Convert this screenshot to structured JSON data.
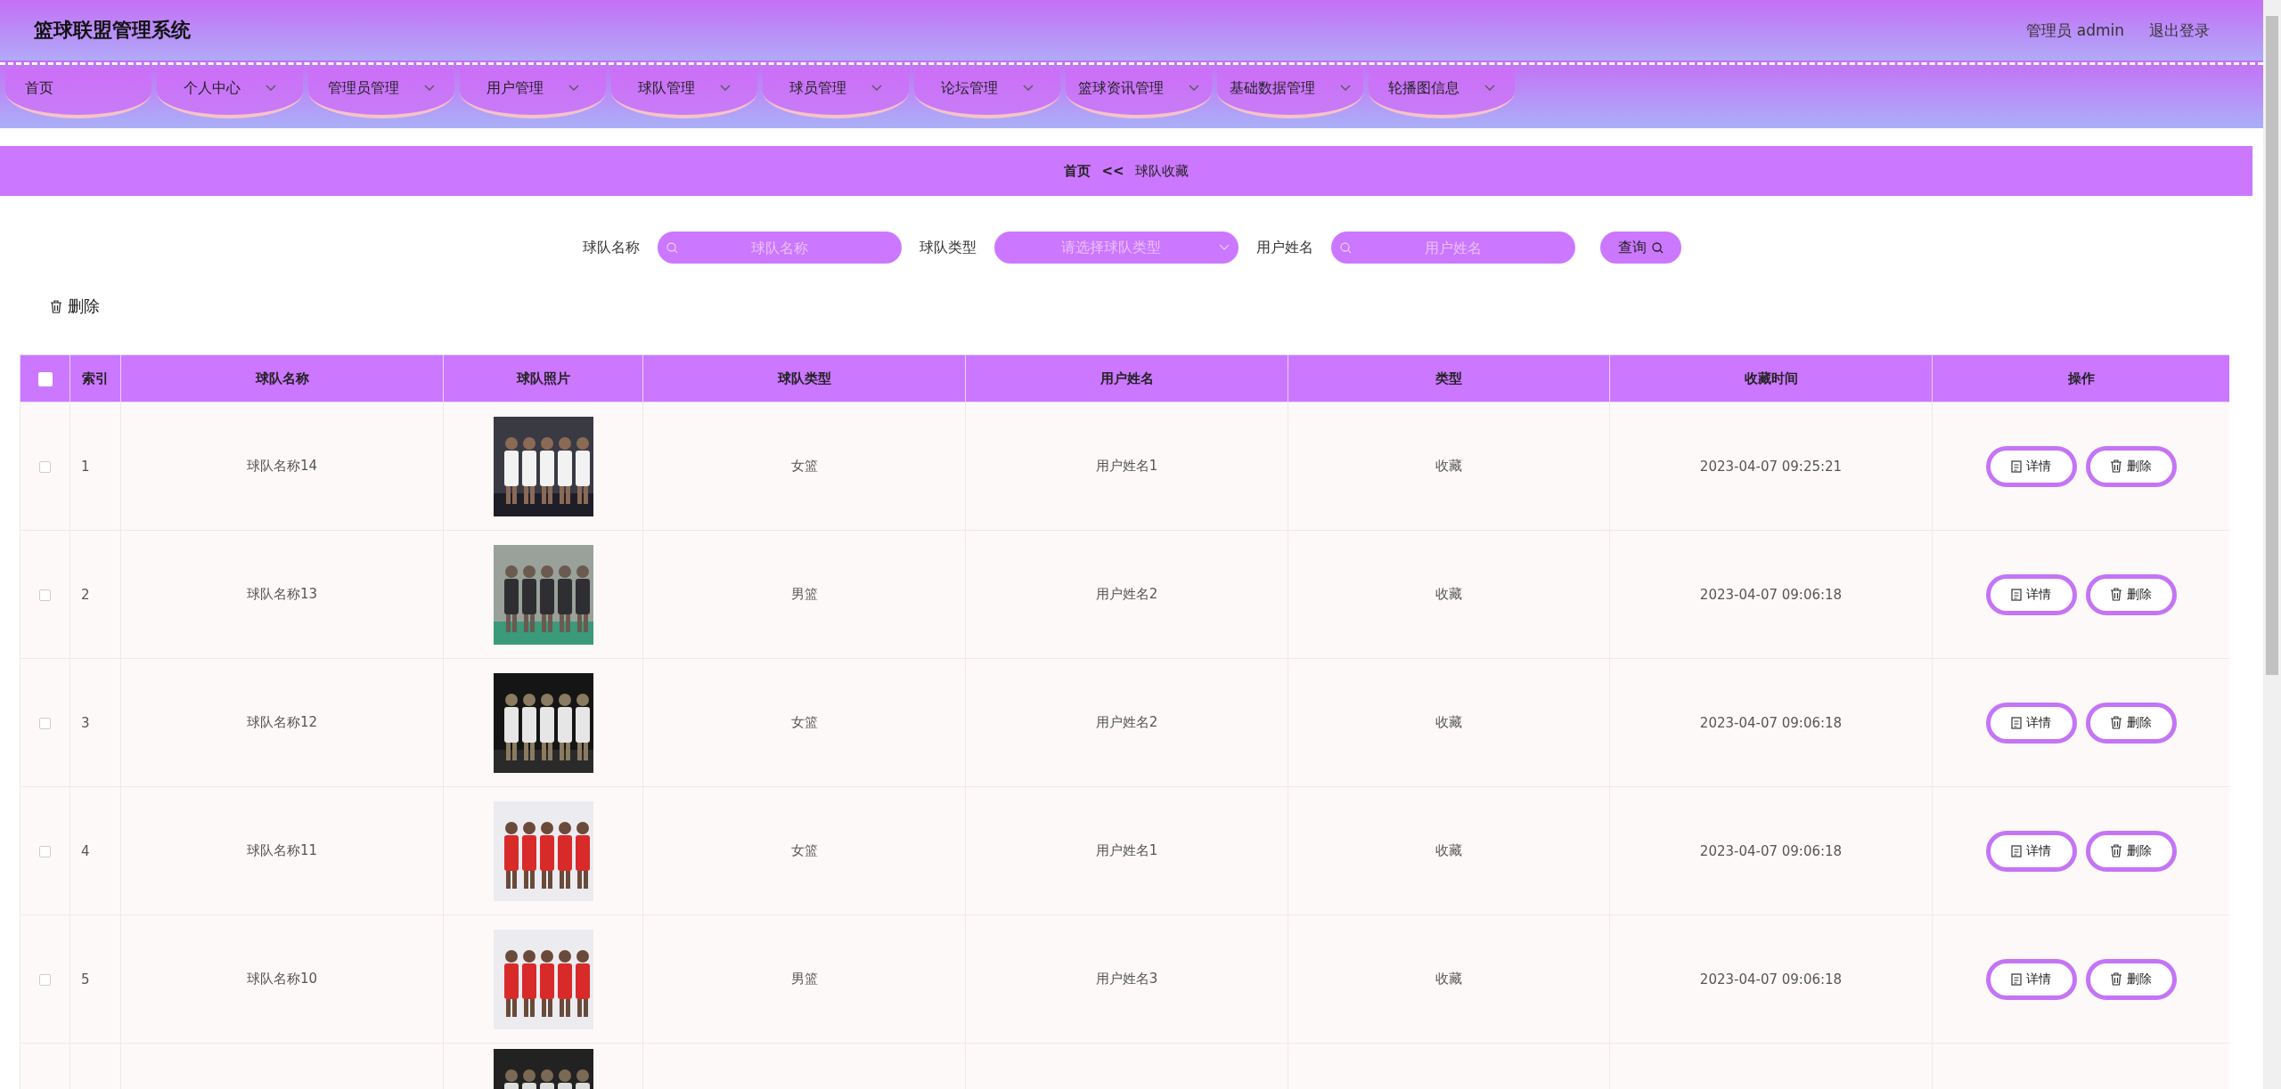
{
  "header": {
    "title": "篮球联盟管理系统",
    "user": "管理员 admin",
    "logout": "退出登录"
  },
  "nav": [
    {
      "label": "首页",
      "has_dropdown": false
    },
    {
      "label": "个人中心",
      "has_dropdown": true
    },
    {
      "label": "管理员管理",
      "has_dropdown": true
    },
    {
      "label": "用户管理",
      "has_dropdown": true
    },
    {
      "label": "球队管理",
      "has_dropdown": true
    },
    {
      "label": "球员管理",
      "has_dropdown": true
    },
    {
      "label": "论坛管理",
      "has_dropdown": true
    },
    {
      "label": "篮球资讯管理",
      "has_dropdown": true
    },
    {
      "label": "基础数据管理",
      "has_dropdown": true
    },
    {
      "label": "轮播图信息",
      "has_dropdown": true
    }
  ],
  "breadcrumb": {
    "home": "首页",
    "separator": "<<",
    "current": "球队收藏"
  },
  "search": {
    "fields": [
      {
        "kind": "text",
        "label": "球队名称",
        "placeholder": "球队名称"
      },
      {
        "kind": "select",
        "label": "球队类型",
        "placeholder": "请选择球队类型"
      },
      {
        "kind": "text",
        "label": "用户姓名",
        "placeholder": "用户姓名"
      }
    ],
    "button": "查询"
  },
  "toolbar": {
    "delete": "删除"
  },
  "table": {
    "select_all": {
      "checked": false
    },
    "columns": [
      "索引",
      "球队名称",
      "球队照片",
      "球队类型",
      "用户姓名",
      "类型",
      "收藏时间",
      "操作"
    ],
    "rows": [
      {
        "checked": false,
        "index": "1",
        "name": "球队名称14",
        "photo": {
          "kind": "picture"
        },
        "team_type": "女篮",
        "user": "用户姓名1",
        "type": "收藏",
        "time": "2023-04-07 09:25:21",
        "actions": [
          "详情",
          "删除"
        ]
      },
      {
        "checked": false,
        "index": "2",
        "name": "球队名称13",
        "photo": {
          "kind": "picture"
        },
        "team_type": "男篮",
        "user": "用户姓名2",
        "type": "收藏",
        "time": "2023-04-07 09:06:18",
        "actions": [
          "详情",
          "删除"
        ]
      },
      {
        "checked": false,
        "index": "3",
        "name": "球队名称12",
        "photo": {
          "kind": "picture"
        },
        "team_type": "女篮",
        "user": "用户姓名2",
        "type": "收藏",
        "time": "2023-04-07 09:06:18",
        "actions": [
          "详情",
          "删除"
        ]
      },
      {
        "checked": false,
        "index": "4",
        "name": "球队名称11",
        "photo": {
          "kind": "picture"
        },
        "team_type": "女篮",
        "user": "用户姓名1",
        "type": "收藏",
        "time": "2023-04-07 09:06:18",
        "actions": [
          "详情",
          "删除"
        ]
      },
      {
        "checked": false,
        "index": "5",
        "name": "球队名称10",
        "photo": {
          "kind": "picture"
        },
        "team_type": "男篮",
        "user": "用户姓名3",
        "type": "收藏",
        "time": "2023-04-07 09:06:18",
        "actions": [
          "详情",
          "删除"
        ]
      },
      {
        "photo": {
          "kind": "picture"
        }
      }
    ]
  }
}
